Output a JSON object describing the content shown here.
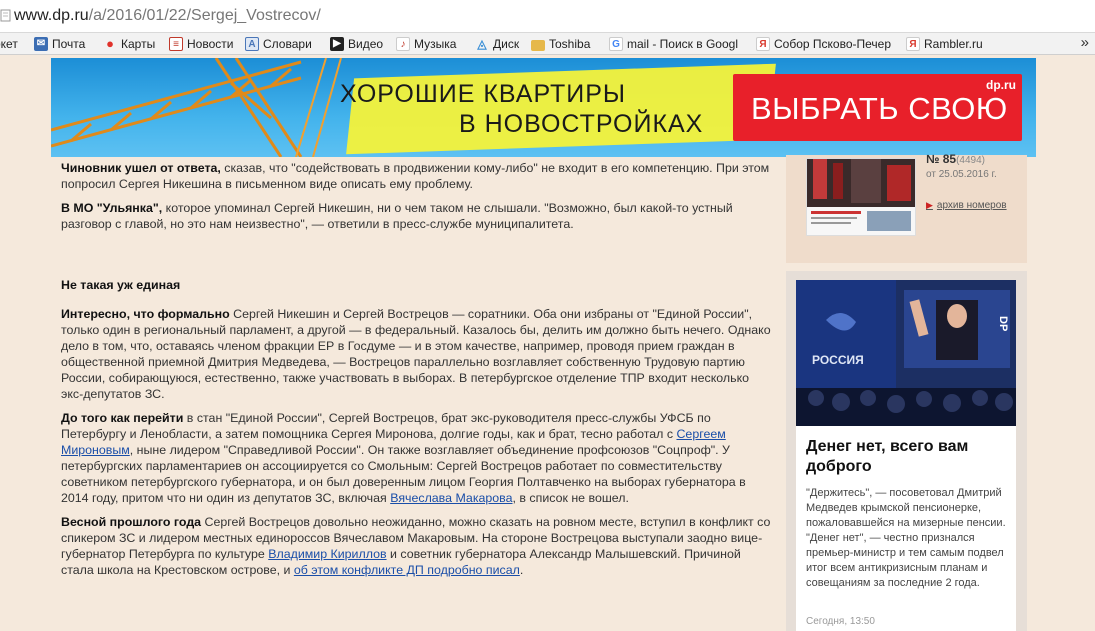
{
  "browser": {
    "url_host": "www.dp.ru",
    "url_path": "/a/2016/01/22/Sergej_Vostrecov/",
    "bookmarks": [
      {
        "label": "окет",
        "icon": "bookmark-icon",
        "color": "#888888"
      },
      {
        "label": "Почта",
        "icon": "mail-icon",
        "color": "#3b6db3"
      },
      {
        "label": "Карты",
        "icon": "map-pin-icon",
        "color": "#e0322b"
      },
      {
        "label": "Новости",
        "icon": "news-icon",
        "color": "#c0392b"
      },
      {
        "label": "Словари",
        "icon": "dictionary-icon",
        "color": "#4a76b8"
      },
      {
        "label": "Видео",
        "icon": "video-icon",
        "color": "#222222"
      },
      {
        "label": "Музыка",
        "icon": "music-icon",
        "color": "#c0392b"
      },
      {
        "label": "Диск",
        "icon": "disk-icon",
        "color": "#3a8fd6"
      },
      {
        "label": "Toshiba",
        "icon": "folder-icon",
        "color": "#e6b84a"
      },
      {
        "label": "mail - Поиск в Googl",
        "icon": "google-icon",
        "color": "#4285f4"
      },
      {
        "label": "Собор Псково-Печер",
        "icon": "yandex-icon",
        "color": "#d93a2e"
      },
      {
        "label": "Rambler.ru",
        "icon": "yandex-icon",
        "color": "#d93a2e"
      }
    ],
    "more": "»"
  },
  "banner": {
    "line1": "ХОРОШИЕ КВАРТИРЫ",
    "line2": "В НОВОСТРОЙКАХ",
    "cta": "ВЫБРАТЬ СВОЮ",
    "logo": "dp.ru"
  },
  "article": {
    "p1_bold": "Чиновник ушел от ответа,",
    "p1_rest": " сказав, что \"содействовать в продвижении кому-либо\" не входит в его компетенцию. При этом попросил Сергея Никешина в письменном виде описать ему проблему.",
    "p2_bold": "В МО \"Ульянка\",",
    "p2_rest": " которое упоминал Сергей Никешин, ни о чем таком не слышали. \"Возможно, был какой-то устный разговор с главой, но это нам неизвестно\", — ответили в пресс-службе муниципалитета.",
    "subheading": "Не такая уж единая",
    "p3_bold": "Интересно, что формально",
    "p3_rest": " Сергей Никешин и Сергей Вострецов — соратники. Оба они избраны от \"Единой России\", только один в региональный парламент, а другой — в федеральный. Казалось бы, делить им должно быть нечего. Однако дело в том, что, оставаясь членом фракции ЕР в Госдуме — и в этом качестве, например, проводя прием граждан в общественной приемной Дмитрия Медведева, — Вострецов параллельно возглавляет собственную Трудовую партию России, собирающуюся, естественно, также участвовать в выборах. В петербургское отделение ТПР входит несколько экс-депутатов ЗС.",
    "p4_bold": "До того как перейти",
    "p4_a": " в стан \"Единой России\", Сергей Вострецов, брат экс-руководителя пресс-службы УФСБ по Петербургу и Ленобласти, а затем помощника Сергея Миронова, долгие годы, как и брат, тесно работал с ",
    "p4_link1": "Сергеем Мироновым",
    "p4_b": ", ныне лидером \"Справедливой России\". Он также возглавляет объединение профсоюзов \"Соцпроф\". У петербургских парламентариев он ассоциируется со Смольным: Сергей Вострецов работает по совместительству советником петербургского губернатора, и он был доверенным лицом Георгия Полтавченко на выборах губернатора в 2014 году, притом что ни один из депутатов ЗС, включая ",
    "p4_link2": "Вячеслава Макарова",
    "p4_c": ", в список не вошел.",
    "p5_bold": "Весной прошлого года",
    "p5_a": " Сергей Вострецов довольно неожиданно, можно сказать на ровном месте, вступил в конфликт со спикером ЗС и лидером местных единороссов Вячеславом Макаровым. На стороне Вострецова выступали заодно вице-губернатор Петербурга по культуре ",
    "p5_link1": "Владимир Кириллов",
    "p5_b": " и советник губернатора Александр Малышевский. Причиной стала школа на Крестовском острове, и ",
    "p5_link2": "об этом конфликте ДП подробно писал",
    "p5_c": "."
  },
  "sidebar": {
    "issue_number": "№ 85",
    "issue_count": "(4494)",
    "issue_date": "от 25.05.2016 г.",
    "archive_link": "архив номеров",
    "news_title": "Денег нет, всего вам доброго",
    "news_text": "\"Держитесь\", — посоветовал Дмитрий Медведев крымской пенсионерке, пожаловавшейся на мизерные пенсии. \"Денег нет\", — честно признался премьер-министр и тем самым подвел итог всем антикризисным планам и совещаниям за последние 2 года.",
    "news_time": "Сегодня, 13:50"
  }
}
